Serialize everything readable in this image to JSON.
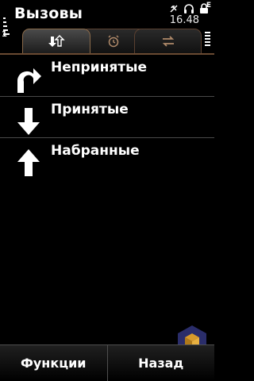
{
  "header": {
    "title": "Вызовы",
    "time": "16.48",
    "signal_indicator": "1",
    "battery_letter": "E"
  },
  "tabs": [
    {
      "icon": "call-arrows-icon",
      "active": true
    },
    {
      "icon": "alarm-clock-icon",
      "active": false
    },
    {
      "icon": "swap-arrows-icon",
      "active": false
    }
  ],
  "list": {
    "items": [
      {
        "label": "Непринятые",
        "icon": "missed-call-arrow-icon"
      },
      {
        "label": "Принятые",
        "icon": "received-call-arrow-icon"
      },
      {
        "label": "Набранные",
        "icon": "dialed-call-arrow-icon"
      }
    ]
  },
  "softkeys": {
    "left": "Функции",
    "right": "Назад"
  },
  "colors": {
    "accent_border": "#8a6a4a",
    "background": "#000000",
    "text": "#ffffff"
  }
}
